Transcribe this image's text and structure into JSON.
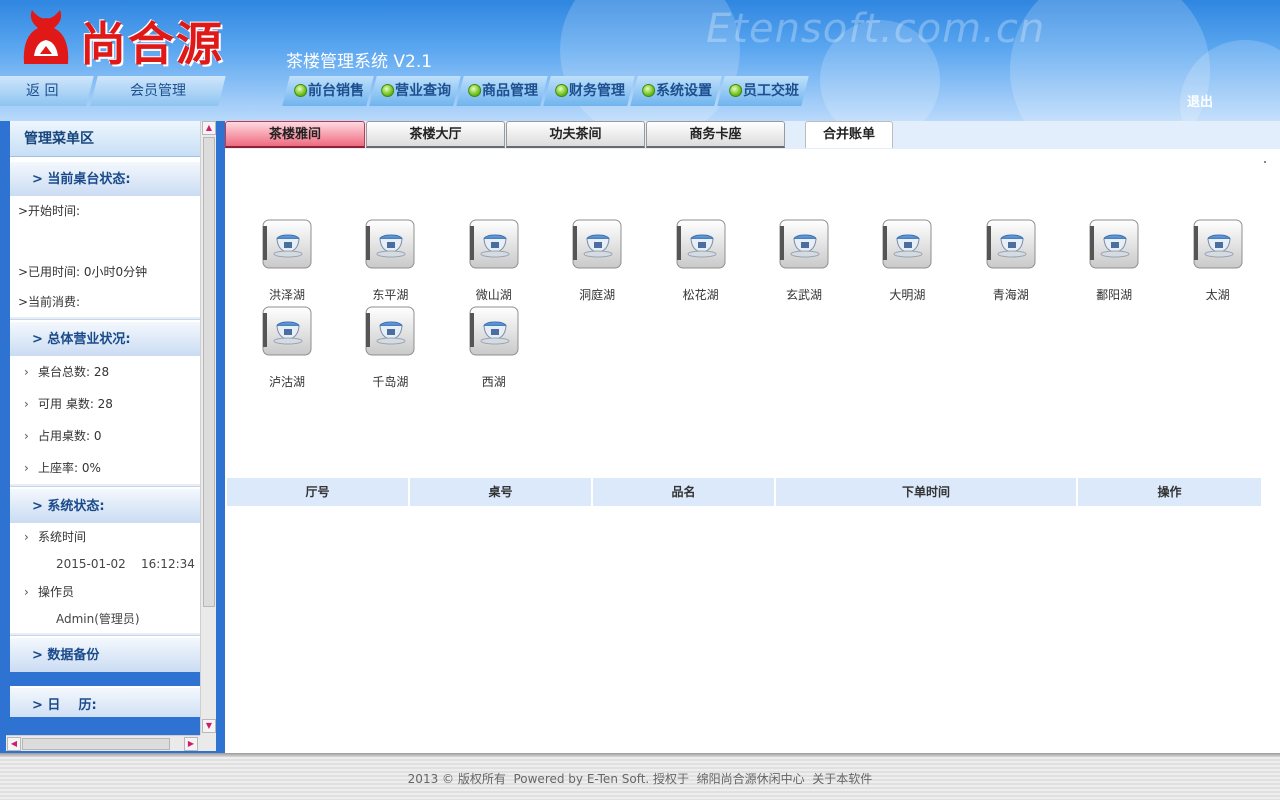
{
  "header": {
    "logo_text": "尚合源",
    "system_title": "茶楼管理系统 V2.1",
    "watermark": "Etensoft.com.cn",
    "logout_label": "退出"
  },
  "nav": {
    "back_label": "返 回",
    "member_label": "会员管理",
    "menu": [
      "前台销售",
      "营业查询",
      "商品管理",
      "财务管理",
      "系统设置",
      "员工交班"
    ]
  },
  "sidebar": {
    "title": "管理菜单区",
    "current_status": {
      "heading": "> 当前桌台状态:",
      "start_time": ">开始时间:",
      "used_time": ">已用时间: 0小时0分钟",
      "current_spend": ">当前消费:"
    },
    "business": {
      "heading": "> 总体营业状况:",
      "total_tables": "桌台总数: 28",
      "available_tables": "可用 桌数: 28",
      "occupied_tables": "占用桌数: 0",
      "occupancy_rate": "上座率: 0%"
    },
    "system": {
      "heading": "> 系统状态:",
      "time_label": "系统时间",
      "time_value": "2015-01-02    16:12:34",
      "operator_label": "操作员",
      "operator_value": "Admin(管理员)"
    },
    "backup_heading": "> 数据备份",
    "calendar_heading": "> 日    历:",
    "calendar_nav": "<< < > >>"
  },
  "tabs": {
    "items": [
      "茶楼雅间",
      "茶楼大厅",
      "功夫茶间",
      "商务卡座"
    ],
    "merge_bill": "合并账单",
    "active_index": 0
  },
  "tables": [
    "洪泽湖",
    "东平湖",
    "微山湖",
    "洞庭湖",
    "松花湖",
    "玄武湖",
    "大明湖",
    "青海湖",
    "鄱阳湖",
    "太湖",
    "泸沽湖",
    "千岛湖",
    "西湖"
  ],
  "order_table": {
    "columns": [
      "厅号",
      "桌号",
      "品名",
      "下单时间",
      "操作"
    ]
  },
  "footer": {
    "text": "2013 © 版权所有  Powered by E-Ten Soft. 授权于  绵阳尚合源休闲中心  关于本软件"
  },
  "colors": {
    "header_blue": "#2f86e0",
    "logo_red": "#e01818",
    "active_tab": "#ef6b80",
    "sidebar_frame": "#2e72d2"
  }
}
